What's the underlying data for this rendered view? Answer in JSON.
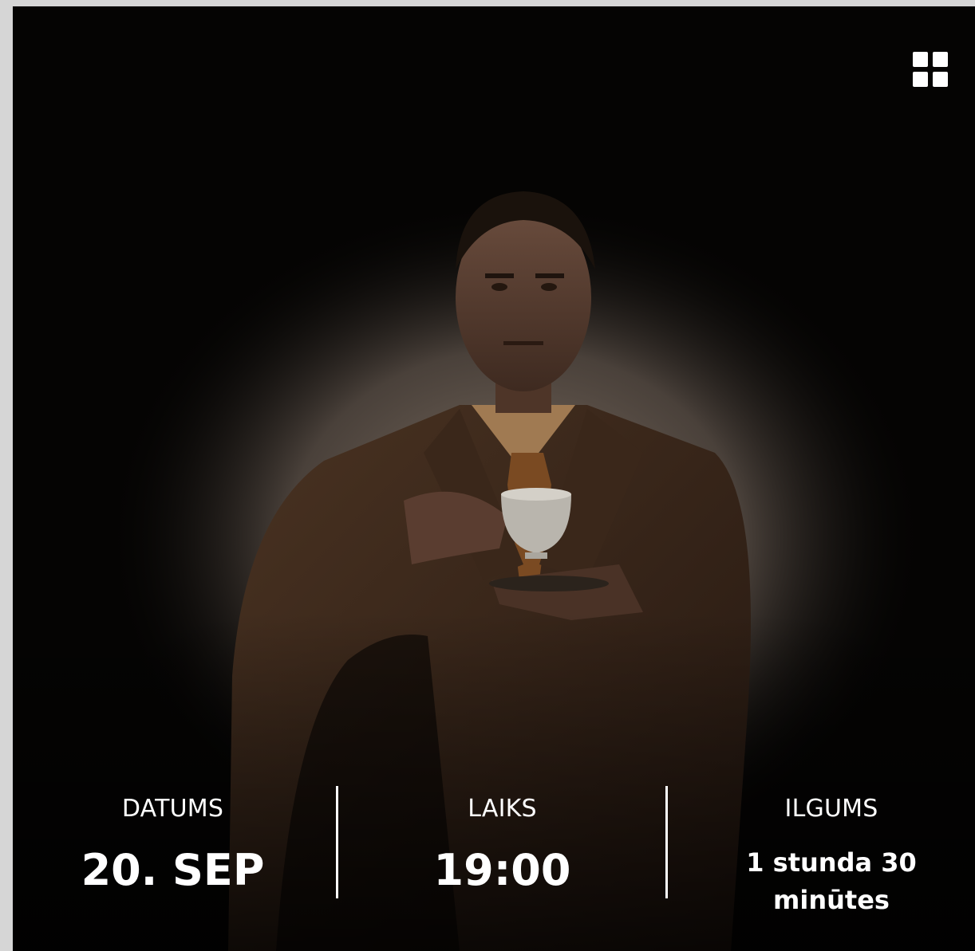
{
  "menu": {
    "icon": "grid-icon"
  },
  "event": {
    "date_label": "DATUMS",
    "date_value": "20. SEP",
    "time_label": "LAIKS",
    "time_value": "19:00",
    "duration_label": "ILGUMS",
    "duration_value": "1 stunda 30 minūtes"
  }
}
